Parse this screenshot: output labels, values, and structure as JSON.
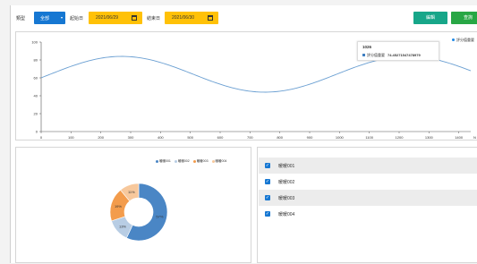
{
  "toolbar": {
    "type_label": "類型",
    "type_value": "全部",
    "start_label": "起始日",
    "start_date": "2021/06/29",
    "end_label": "結束日",
    "end_date": "2021/06/30",
    "edit_label": "編輯",
    "search_label": "查詢"
  },
  "chart": {
    "legend": "評分值重要",
    "legend_color": "#1e88e5",
    "line_color": "#6a9fd2",
    "y_ticks": [
      "100",
      "80",
      "60",
      "40",
      "20",
      "0"
    ],
    "x_ticks": [
      "0",
      "100",
      "200",
      "300",
      "400",
      "500",
      "600",
      "700",
      "800",
      "900",
      "1000",
      "1100",
      "1200",
      "1300",
      "1400"
    ],
    "x_unit": "N",
    "tooltip": {
      "title": "1026",
      "series": "評分值重要",
      "value": "74.45271547478979"
    }
  },
  "chart_data": {
    "type": "line",
    "x_range": [
      0,
      1440
    ],
    "ylim": [
      0,
      100
    ],
    "series": [
      {
        "name": "評分值重要",
        "description_points": [
          [
            0,
            57
          ],
          [
            270,
            84
          ],
          [
            750,
            44
          ],
          [
            1230,
            84
          ],
          [
            1440,
            63
          ]
        ]
      }
    ],
    "grid": false,
    "legend_position": "top-right"
  },
  "pie": {
    "legend": [
      {
        "label": "暖暖001",
        "color": "#4a86c5"
      },
      {
        "label": "暖暖002",
        "color": "#b8cde4"
      },
      {
        "label": "暖暖003",
        "color": "#f39c4c"
      },
      {
        "label": "暖暖004",
        "color": "#f7c89c"
      }
    ],
    "slices": [
      {
        "label": "暖暖001",
        "value": 57,
        "text": "57%",
        "color": "#4a86c5"
      },
      {
        "label": "暖暖002",
        "value": 13,
        "text": "13%",
        "color": "#b8cde4"
      },
      {
        "label": "暖暖003",
        "value": 19,
        "text": "19%",
        "color": "#f39c4c"
      },
      {
        "label": "暖暖004",
        "value": 11,
        "text": "11%",
        "color": "#f7c89c"
      }
    ]
  },
  "list": {
    "items": [
      {
        "label": "暖暖001",
        "checked": true
      },
      {
        "label": "暖暖002",
        "checked": true
      },
      {
        "label": "暖暖003",
        "checked": true
      },
      {
        "label": "暖暖004",
        "checked": true
      }
    ]
  }
}
